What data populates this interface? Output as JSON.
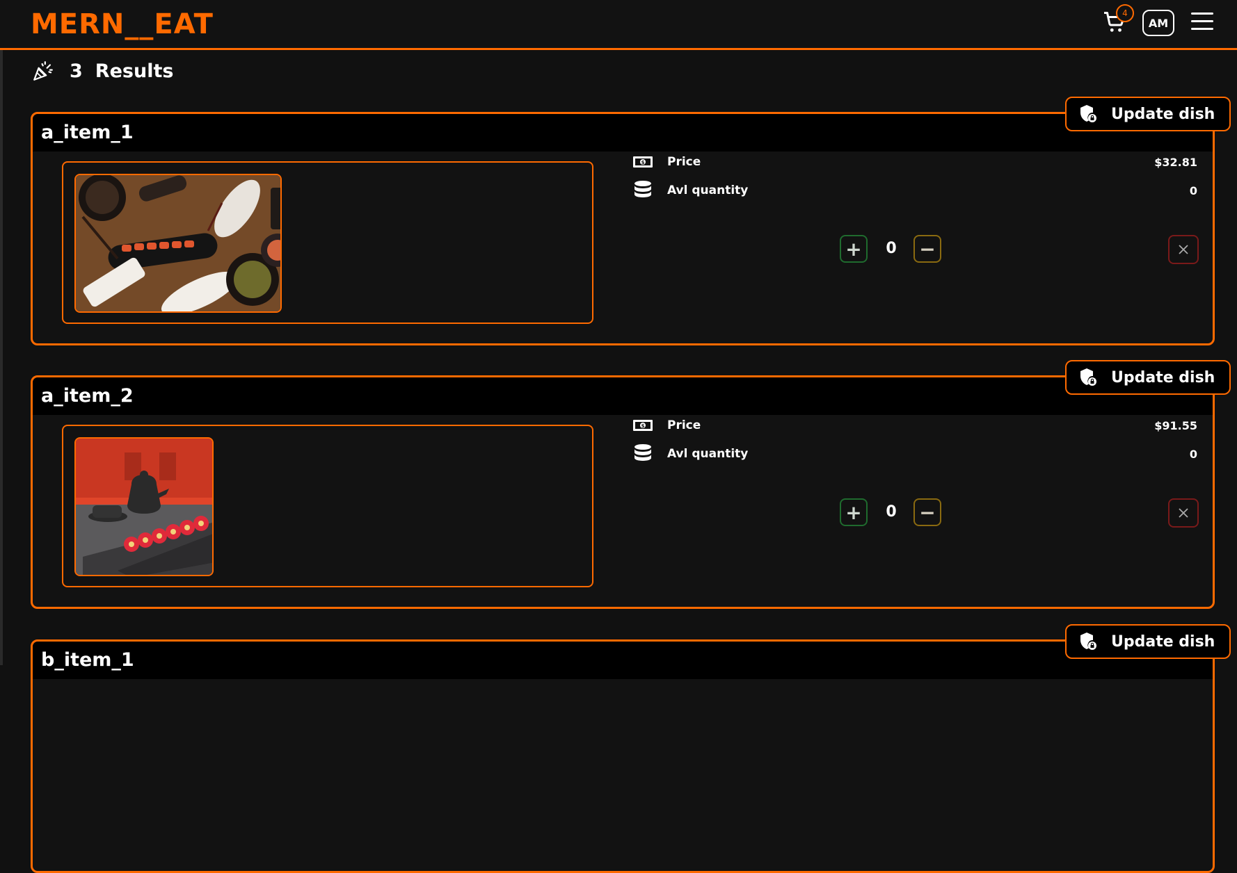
{
  "brand": "MERN__EAT",
  "cart": {
    "count": "4"
  },
  "user": {
    "initials": "AM"
  },
  "results": {
    "count": "3",
    "label": "Results"
  },
  "labels": {
    "price": "Price",
    "quantity": "Avl quantity",
    "update": "Update dish"
  },
  "dishes": [
    {
      "name": "a_item_1",
      "price": "$32.81",
      "avl_quantity": "0",
      "selected_qty": "0"
    },
    {
      "name": "a_item_2",
      "price": "$91.55",
      "avl_quantity": "0",
      "selected_qty": "0"
    },
    {
      "name": "b_item_1"
    }
  ],
  "colors": {
    "accent": "#ff6a00",
    "background": "#111111",
    "plus": "#1f6b2e",
    "minus": "#8a6a10",
    "remove": "#7a1a1a"
  }
}
